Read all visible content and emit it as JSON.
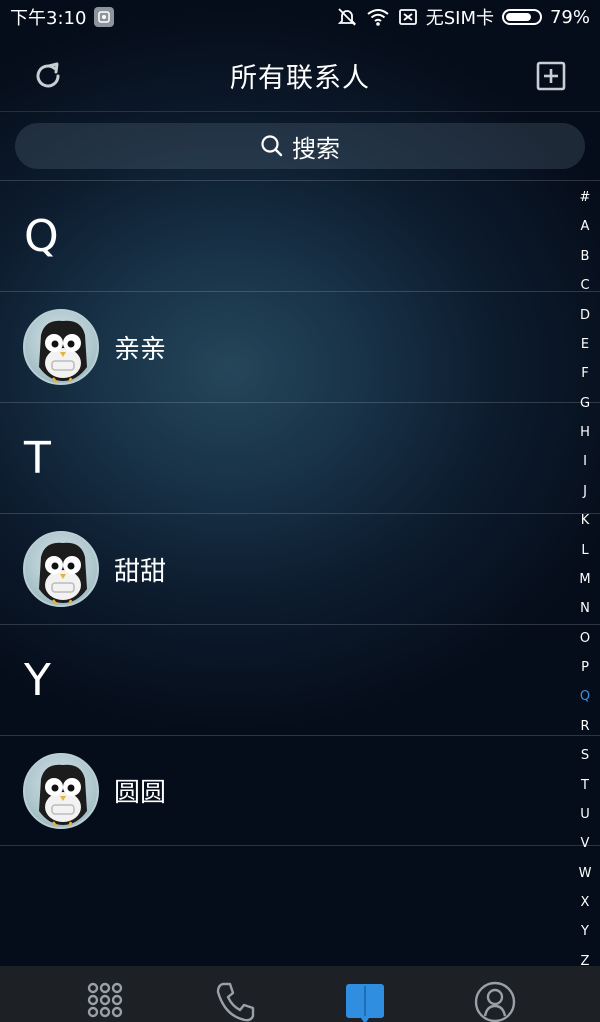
{
  "status_bar": {
    "time": "下午3:10",
    "carrier": "无SIM卡",
    "battery_percent": "79%",
    "battery_level": 0.79
  },
  "header": {
    "title": "所有联系人",
    "left_icon": "refresh-icon",
    "right_icon": "add-contact-icon"
  },
  "search": {
    "label": "搜索",
    "icon": "search-icon"
  },
  "contacts": [
    {
      "type": "section",
      "letter": "Q"
    },
    {
      "type": "contact",
      "name": "亲亲"
    },
    {
      "type": "section",
      "letter": "T"
    },
    {
      "type": "contact",
      "name": "甜甜"
    },
    {
      "type": "section",
      "letter": "Y"
    },
    {
      "type": "contact",
      "name": "圆圆"
    }
  ],
  "index": {
    "letters": [
      "#",
      "A",
      "B",
      "C",
      "D",
      "E",
      "F",
      "G",
      "H",
      "I",
      "J",
      "K",
      "L",
      "M",
      "N",
      "O",
      "P",
      "Q",
      "R",
      "S",
      "T",
      "U",
      "V",
      "W",
      "X",
      "Y",
      "Z"
    ],
    "active": "Q",
    "active_color": "#3d8fd6"
  },
  "bottom_nav": [
    {
      "icon": "dialpad-icon"
    },
    {
      "icon": "phone-icon"
    },
    {
      "icon": "contacts-book-icon",
      "active": true,
      "color": "#2f8ee0"
    },
    {
      "icon": "profile-icon"
    }
  ]
}
